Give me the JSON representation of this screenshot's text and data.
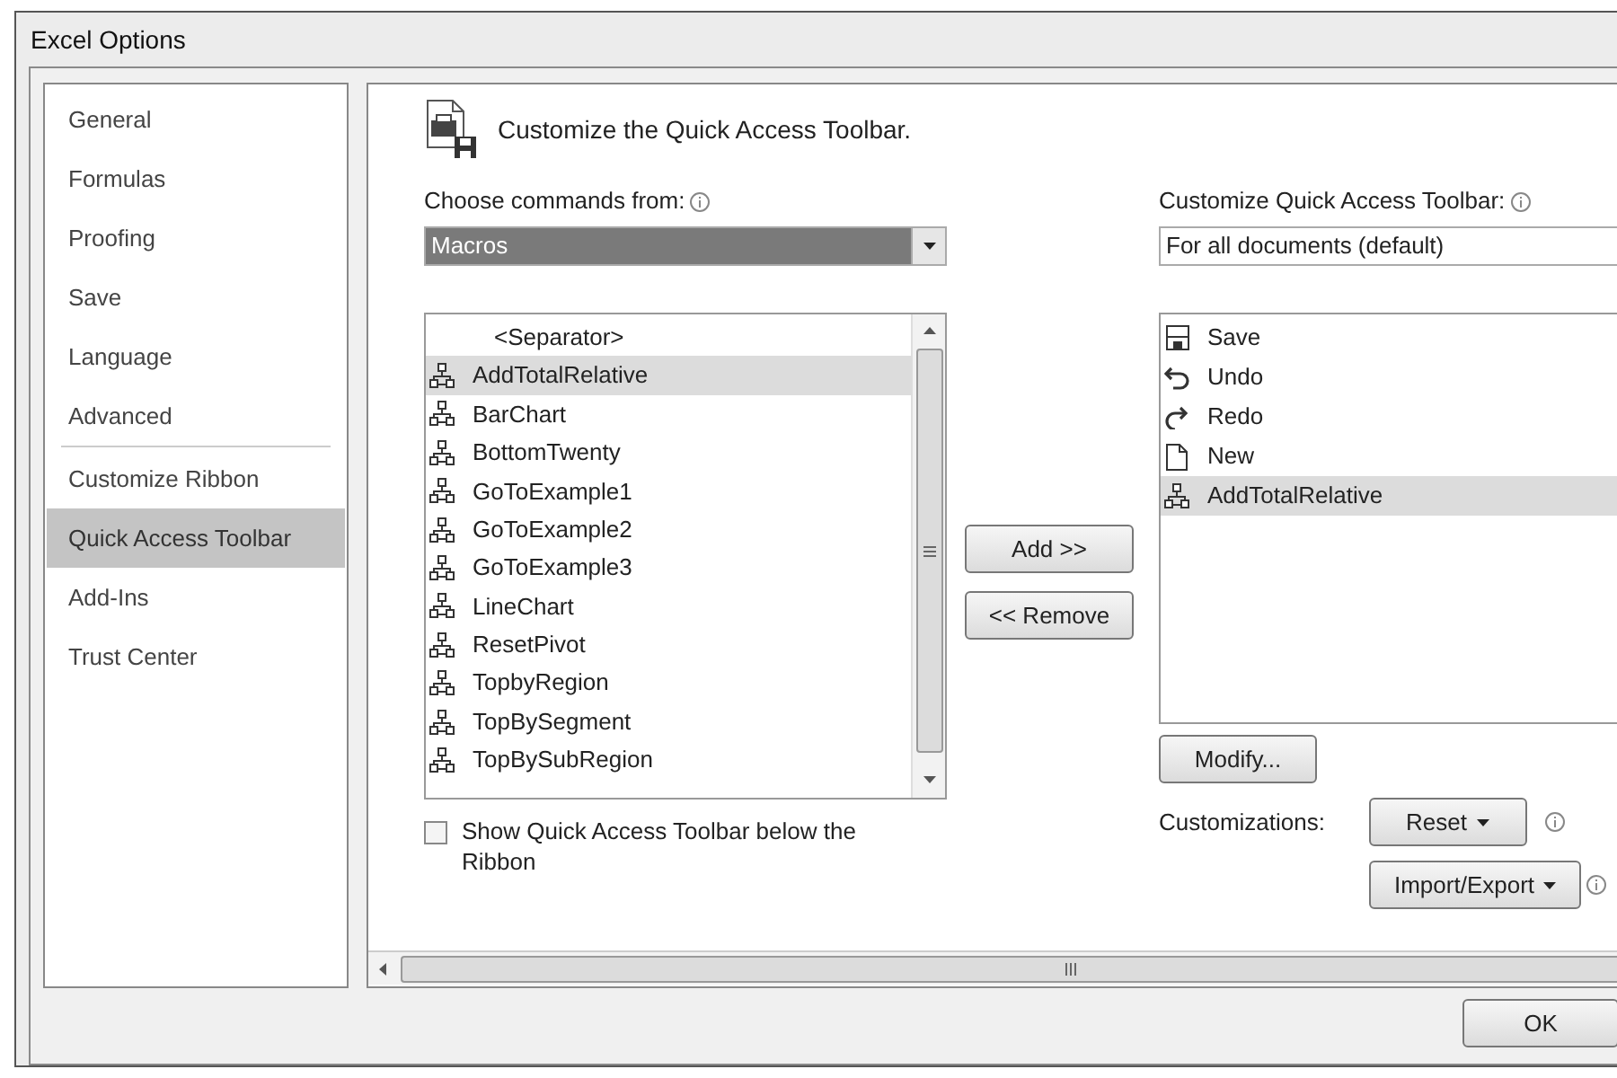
{
  "window": {
    "title": "Excel Options"
  },
  "sidebar": {
    "groups": [
      [
        {
          "label": "General",
          "selected": false
        },
        {
          "label": "Formulas",
          "selected": false
        },
        {
          "label": "Proofing",
          "selected": false
        },
        {
          "label": "Save",
          "selected": false
        },
        {
          "label": "Language",
          "selected": false
        },
        {
          "label": "Advanced",
          "selected": false
        }
      ],
      [
        {
          "label": "Customize Ribbon",
          "selected": false
        },
        {
          "label": "Quick Access Toolbar",
          "selected": true
        },
        {
          "label": "Add-Ins",
          "selected": false
        },
        {
          "label": "Trust Center",
          "selected": false
        }
      ]
    ]
  },
  "header": {
    "title": "Customize the Quick Access Toolbar."
  },
  "commands": {
    "label": "Choose commands from:",
    "dropdown": {
      "value": "Macros",
      "selected": true
    },
    "items": [
      {
        "label": "<Separator>",
        "kind": "separator",
        "selected": false
      },
      {
        "label": "AddTotalRelative",
        "kind": "macro",
        "selected": true
      },
      {
        "label": "BarChart",
        "kind": "macro",
        "selected": false
      },
      {
        "label": "BottomTwenty",
        "kind": "macro",
        "selected": false
      },
      {
        "label": "GoToExample1",
        "kind": "macro",
        "selected": false
      },
      {
        "label": "GoToExample2",
        "kind": "macro",
        "selected": false
      },
      {
        "label": "GoToExample3",
        "kind": "macro",
        "selected": false
      },
      {
        "label": "LineChart",
        "kind": "macro",
        "selected": false
      },
      {
        "label": "ResetPivot",
        "kind": "macro",
        "selected": false
      },
      {
        "label": "TopbyRegion",
        "kind": "macro",
        "selected": false
      },
      {
        "label": "TopBySegment",
        "kind": "macro",
        "selected": false
      },
      {
        "label": "TopBySubRegion",
        "kind": "macro",
        "selected": false
      }
    ]
  },
  "add_button": "Add >>",
  "remove_button": "<< Remove",
  "show_below": {
    "label": "Show Quick Access Toolbar below the Ribbon",
    "checked": false
  },
  "toolbar": {
    "label": "Customize Quick Access Toolbar:",
    "dropdown": {
      "value": "For all documents (default)"
    },
    "items": [
      {
        "label": "Save",
        "kind": "save",
        "selected": false
      },
      {
        "label": "Undo",
        "kind": "undo",
        "selected": false
      },
      {
        "label": "Redo",
        "kind": "redo",
        "selected": false
      },
      {
        "label": "New",
        "kind": "new",
        "selected": false
      },
      {
        "label": "AddTotalRelative",
        "kind": "macro",
        "selected": true
      }
    ],
    "modify_button": "Modify...",
    "customizations": {
      "label": "Customizations:",
      "reset_button": "Reset",
      "import_export_button": "Import/Export"
    }
  },
  "buttons": [
    "OK"
  ]
}
